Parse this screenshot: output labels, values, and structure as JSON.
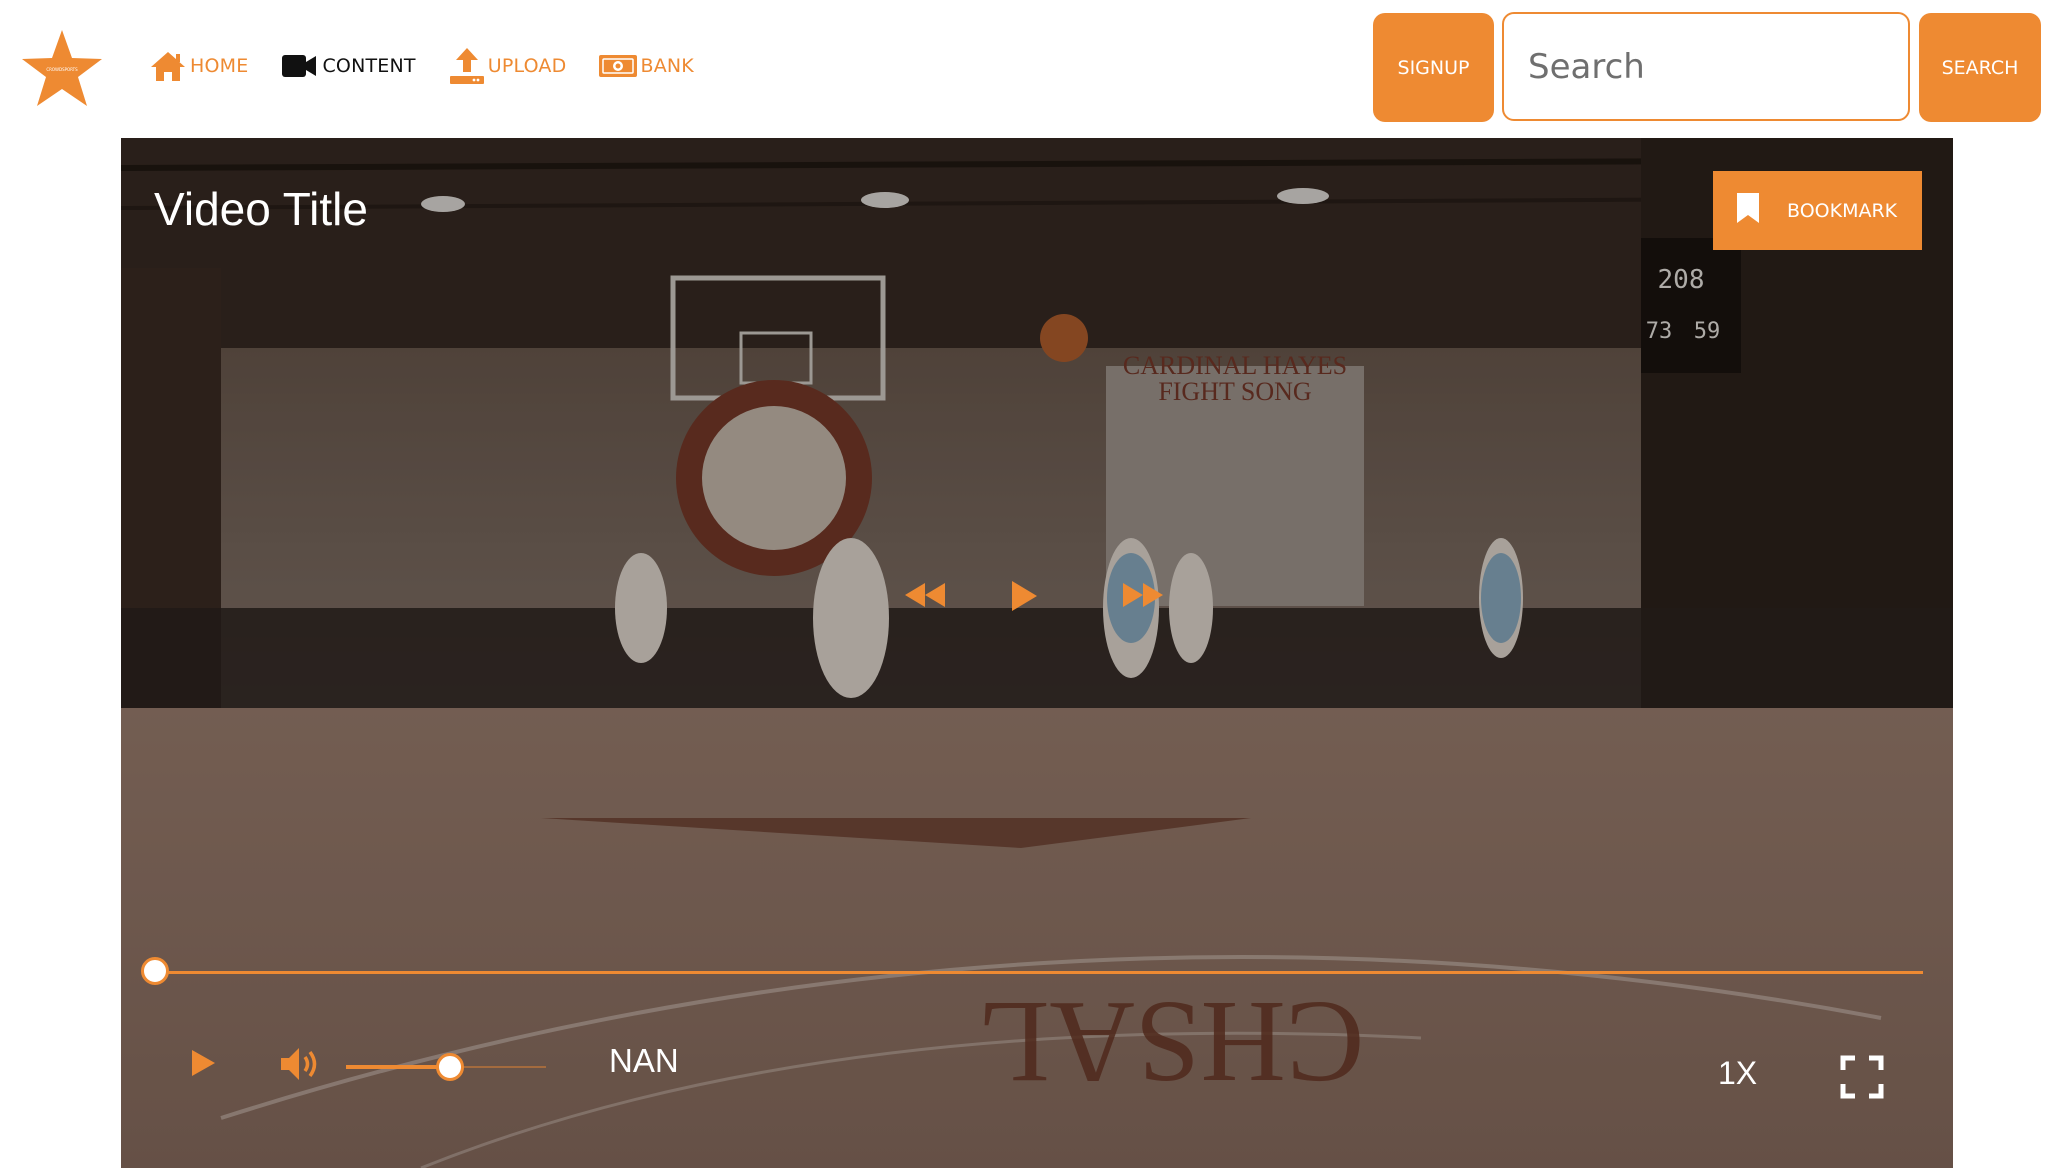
{
  "colors": {
    "accent": "#EE8A32",
    "overlay_text": "#FFFFFF"
  },
  "logo": {
    "icon": "star-logo-icon",
    "tiny_text": "CROWDSPORTS"
  },
  "nav": {
    "items": [
      {
        "label": "HOME",
        "icon": "home-icon"
      },
      {
        "label": "CONTENT",
        "icon": "video-camera-icon"
      },
      {
        "label": "UPLOAD",
        "icon": "upload-icon"
      },
      {
        "label": "BANK",
        "icon": "money-icon"
      }
    ]
  },
  "header": {
    "signup_label": "SIGNUP",
    "search_placeholder": "Search",
    "search_value": "",
    "search_button_label": "SEARCH"
  },
  "player": {
    "title": "Video Title",
    "bookmark_label": "BOOKMARK",
    "bookmark_icon": "bookmark-icon",
    "progress_fraction": 0.0,
    "volume_fraction": 0.52,
    "time_display": "NAN",
    "speed_label": "1X",
    "scene": {
      "banner_line1": "CARDINAL HAYES",
      "banner_line2": "FIGHT SONG",
      "scoreboard_top": "208",
      "scoreboard_left": "73",
      "scoreboard_right": "59",
      "court_text": "CHSAL"
    }
  }
}
